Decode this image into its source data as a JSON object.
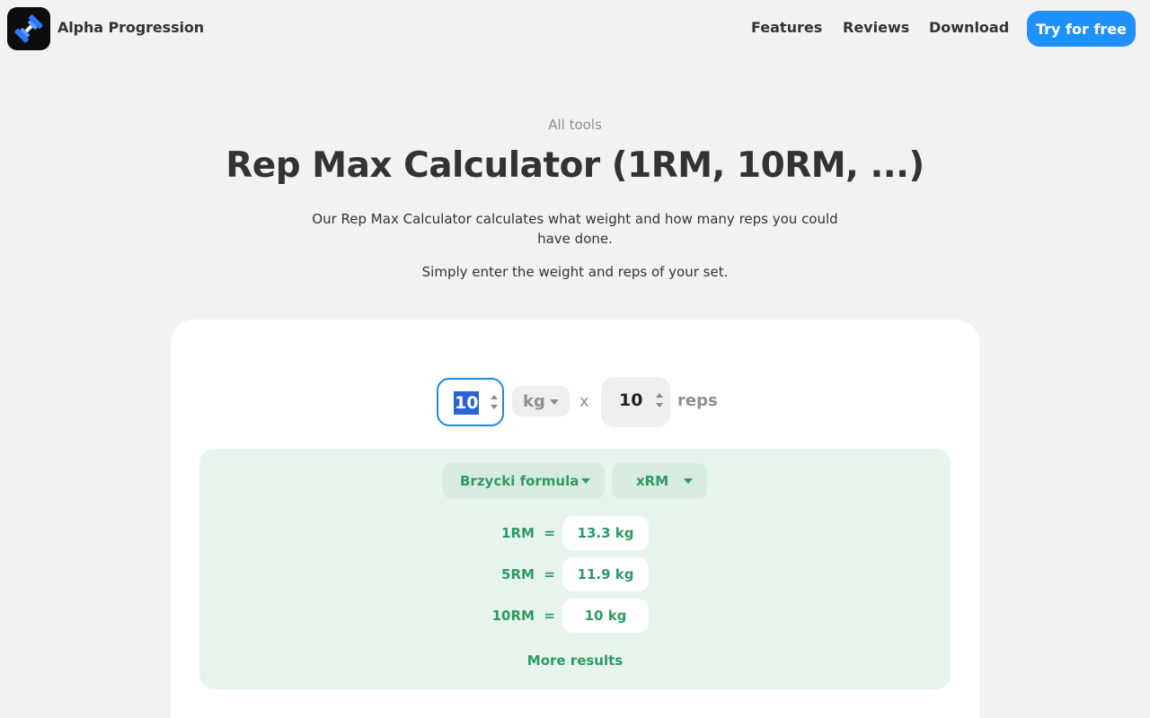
{
  "header": {
    "brand": "Alpha Progression",
    "nav": {
      "features": "Features",
      "reviews": "Reviews",
      "download": "Download"
    },
    "cta": "Try for free",
    "logo_icon": "dumbbell-icon",
    "accent_color": "#1e90ff"
  },
  "hero": {
    "breadcrumb": "All tools",
    "title": "Rep Max Calculator (1RM, 10RM, ...)",
    "description": "Our Rep Max Calculator calculates what weight and how many reps you could have done.",
    "instruction": "Simply enter the weight and reps of your set."
  },
  "calculator": {
    "weight_value": "10",
    "unit": "kg",
    "times": "x",
    "reps_value": "10",
    "reps_label": "reps",
    "formula": "Brzycki formula",
    "mode": "xRM",
    "results": [
      {
        "label": "1RM",
        "eq": "=",
        "value": "13.3 kg"
      },
      {
        "label": "5RM",
        "eq": "=",
        "value": "11.9 kg"
      },
      {
        "label": "10RM",
        "eq": "=",
        "value": "10 kg"
      }
    ],
    "more_results": "More results",
    "result_color": "#2e9a63"
  }
}
